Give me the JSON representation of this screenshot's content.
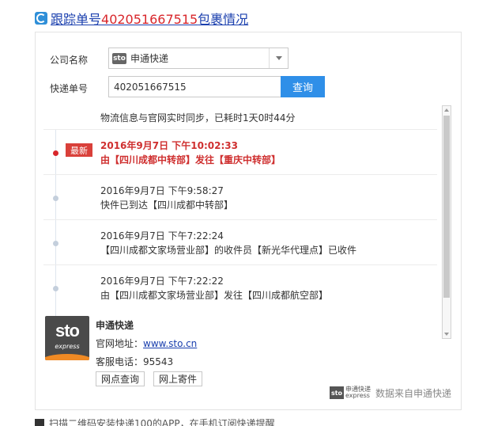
{
  "title": {
    "prefix": "跟踪单号",
    "number": "402051667515",
    "suffix": "包裹情况"
  },
  "form": {
    "company_label": "公司名称",
    "company_value": "申通快递",
    "company_logo_text": "sto",
    "number_label": "快递单号",
    "number_value": "402051667515",
    "query_label": "查询"
  },
  "tracking": {
    "sync_text": "物流信息与官网实时同步，已耗时1天0时44分",
    "entries": [
      {
        "badge": "最新",
        "time": "2016年9月7日 下午10:02:33",
        "desc": "由【四川成都中转部】发往【重庆中转部】"
      },
      {
        "time": "2016年9月7日 下午9:58:27",
        "desc": "快件已到达【四川成都中转部】"
      },
      {
        "time": "2016年9月7日 下午7:22:24",
        "desc": "【四川成都文家场营业部】的收件员【新光华代理点】已收件"
      },
      {
        "time": "2016年9月7日 下午7:22:22",
        "desc": "由【四川成都文家场营业部】发往【四川成都航空部】"
      }
    ]
  },
  "company": {
    "logo_main": "sto",
    "logo_sub": "express",
    "name": "申通快递",
    "site_label": "官网地址：",
    "site_url": "www.sto.cn",
    "phone_label": "客服电话：",
    "phone": "95543",
    "btn_outlets": "网点查询",
    "btn_ship": "网上寄件"
  },
  "source": {
    "logo_box": "sto",
    "logo_line1": "申通快递",
    "logo_line2": "express",
    "label": "数据来自申通快递"
  },
  "footer": {
    "text": "扫描二维码安装快递100的APP，在手机订阅快递提醒"
  },
  "colors": {
    "accent": "#2f8fe8",
    "latest": "#cf2f2f",
    "link": "#1a3fae"
  }
}
